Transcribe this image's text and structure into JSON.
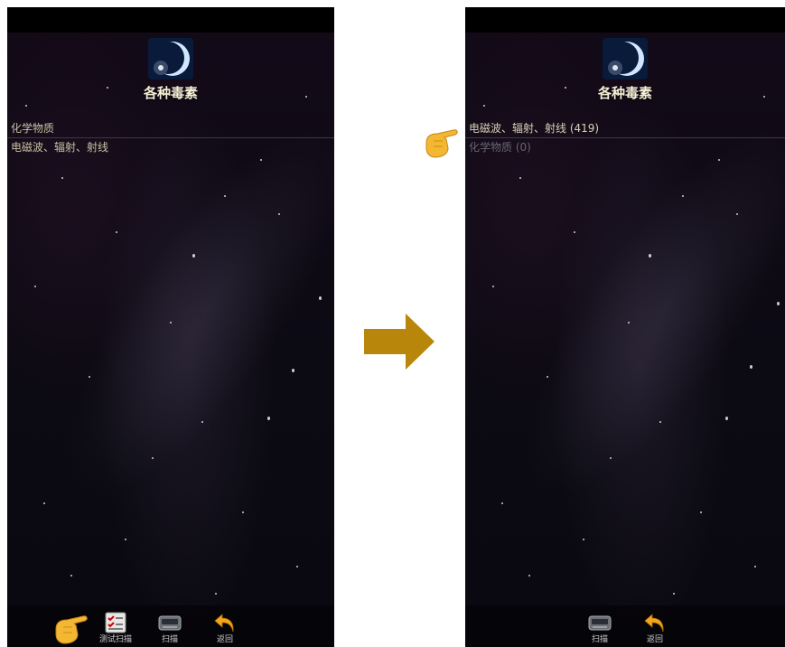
{
  "left_screen": {
    "title": "各种毒素",
    "list_items": [
      "化学物质",
      "电磁波、辐射、射线"
    ],
    "toolbar": {
      "test_scan_label": "测试扫描",
      "scan_label": "扫描",
      "back_label": "返回"
    }
  },
  "right_screen": {
    "title": "各种毒素",
    "list_items": [
      "电磁波、辐射、射线 (419)",
      "化学物质 (0)"
    ],
    "toolbar": {
      "scan_label": "扫描",
      "back_label": "返回"
    }
  },
  "icons": {
    "logo": "planet-eclipse-logo-icon",
    "test_scan": "checklist-icon",
    "scan": "scanner-device-icon",
    "back": "back-arrow-icon",
    "transition": "right-arrow-icon",
    "pointer": "pointing-hand-icon"
  },
  "colors": {
    "title_text": "#f5efd7",
    "item_text": "#c9c2a3",
    "dim_item_text": "#6a6575",
    "transition_arrow": "#b8860b",
    "pointer_hand": "#f4b731"
  }
}
